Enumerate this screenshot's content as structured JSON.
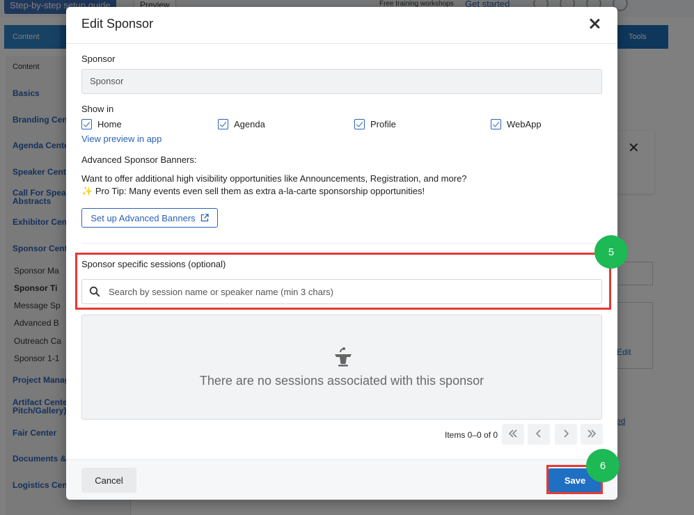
{
  "background": {
    "setup_guide": "Step-by-step setup guide",
    "preview": "Preview",
    "training": "Free training workshops",
    "get_started": "Get started",
    "tab_content": "Content",
    "tab_tools": "Tools",
    "sidebar_header": "Content",
    "sidebar_items": [
      "Basics",
      "Branding Cen",
      "Agenda Cente",
      "Speaker Cent",
      "Call For Speal",
      "Abstracts",
      "Exhibitor Cen",
      "Sponsor Cent",
      "Project Manag",
      "Artifact Cente",
      "Pitch/Gallery)",
      "Fair Center",
      "Documents &",
      "Logistics Cen"
    ],
    "sidebar_subitems": [
      "Sponsor Ma",
      "Sponsor Ti",
      "Message Sp",
      "Advanced B",
      "Outreach Ca",
      "Sponsor 1-1"
    ],
    "edit_label": "Edit",
    "link_frag": "ed"
  },
  "modal": {
    "title": "Edit Sponsor",
    "sponsor_label": "Sponsor",
    "sponsor_value": "Sponsor",
    "show_in_label": "Show in",
    "show_in_options": [
      {
        "label": "Home",
        "checked": true
      },
      {
        "label": "Agenda",
        "checked": true
      },
      {
        "label": "Profile",
        "checked": true
      },
      {
        "label": "WebApp",
        "checked": true
      }
    ],
    "view_preview": "View preview in app",
    "advanced_title": "Advanced Sponsor Banners:",
    "advanced_desc": "Want to offer additional high visibility opportunities like Announcements, Registration, and more?",
    "pro_tip_icon": "✨",
    "pro_tip": "Pro Tip: Many events even sell them as extra a-la-carte sponsorship opportunities!",
    "setup_banners": "Set up Advanced Banners",
    "sessions_label": "Sponsor specific sessions (optional)",
    "search_placeholder": "Search by session name or speaker name (min 3 chars)",
    "empty_text": "There are no sessions associated with this sponsor",
    "pager_text": "Items 0–0 of 0",
    "cancel": "Cancel",
    "save": "Save"
  },
  "annotations": {
    "step_5": "5",
    "step_6": "6",
    "highlight_color": "#e53935",
    "badge_color": "#1db954"
  },
  "colors": {
    "primary": "#1f6fc3",
    "link": "#2a62b7"
  }
}
